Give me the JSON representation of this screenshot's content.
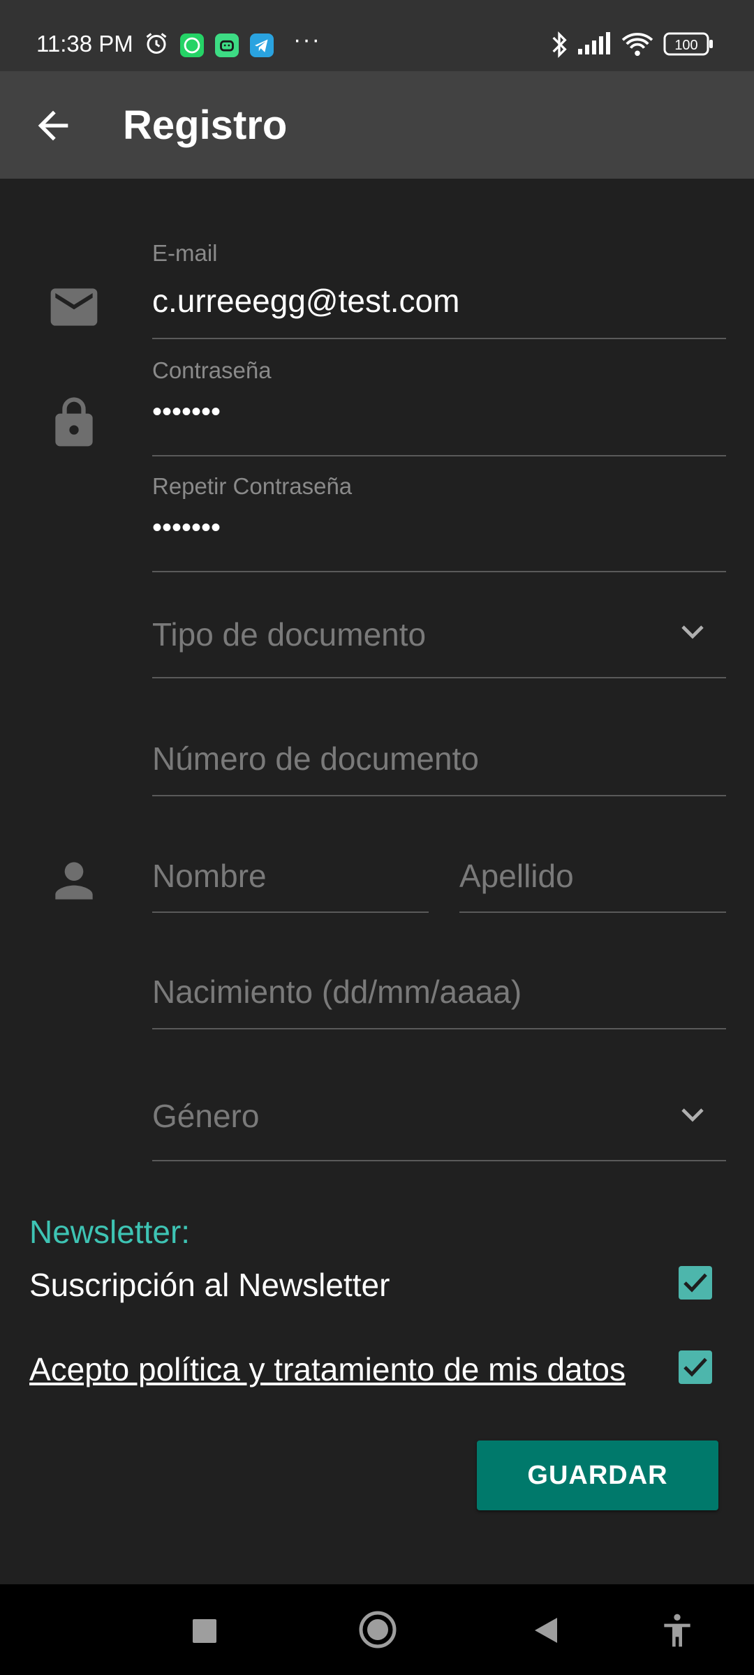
{
  "status_bar": {
    "time": "11:38 PM",
    "overflow": "···",
    "battery": "100"
  },
  "app_bar": {
    "title": "Registro"
  },
  "form": {
    "email": {
      "label": "E-mail",
      "value": "c.urreeegg@test.com"
    },
    "password": {
      "label": "Contraseña",
      "value": "•••••••"
    },
    "repeat_password": {
      "label": "Repetir Contraseña",
      "value": "•••••••"
    },
    "document_type": {
      "placeholder": "Tipo de documento"
    },
    "document_number": {
      "placeholder": "Número de documento"
    },
    "first_name": {
      "placeholder": "Nombre"
    },
    "last_name": {
      "placeholder": "Apellido"
    },
    "birth_date": {
      "placeholder": "Nacimiento (dd/mm/aaaa)"
    },
    "gender": {
      "placeholder": "Género"
    }
  },
  "newsletter": {
    "heading": "Newsletter:",
    "subscription_label": "Suscripción al Newsletter",
    "subscription_checked": true,
    "policy_label": "Acepto política y tratamiento de mis datos",
    "policy_checked": true
  },
  "actions": {
    "save_label": "GUARDAR"
  },
  "colors": {
    "accent": "#3ec4b4",
    "checkbox": "#4db6ac",
    "button": "#00796b",
    "background": "#202020",
    "app_bar": "#424242"
  }
}
